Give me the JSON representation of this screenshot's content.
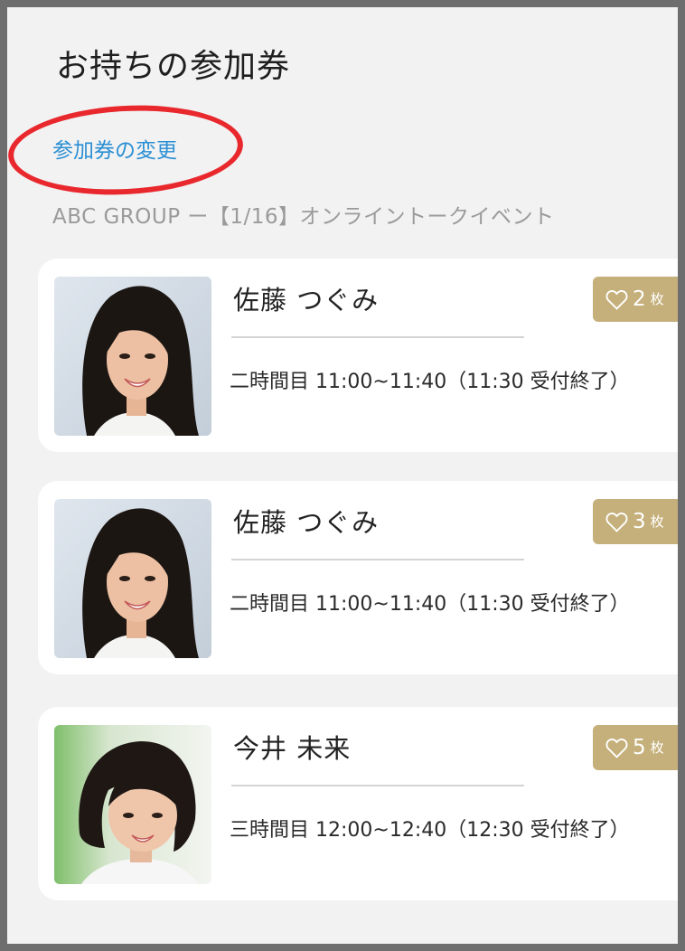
{
  "header": {
    "title": "お持ちの参加券",
    "change_link": "参加券の変更",
    "event_name": "ABC GROUP ー【1/16】オンライントークイベント"
  },
  "tickets": [
    {
      "member_name": "佐藤 つぐみ",
      "slot": "二時間目 11:00~11:40（11:30 受付終了）",
      "count": "2",
      "unit": "枚",
      "icon": "heart-outline-icon"
    },
    {
      "member_name": "佐藤 つぐみ",
      "slot": "二時間目 11:00~11:40（11:30 受付終了）",
      "count": "3",
      "unit": "枚",
      "icon": "heart-outline-icon"
    },
    {
      "member_name": "今井 未来",
      "slot": "三時間目 12:00~12:40（12:30 受付終了）",
      "count": "5",
      "unit": "枚",
      "icon": "heart-outline-icon"
    }
  ],
  "colors": {
    "background": "#f2f2f2",
    "link": "#2b8fd4",
    "highlight": "#e8282d",
    "badge": "#c5b07b",
    "muted_text": "#9a9a9a",
    "card": "#ffffff"
  }
}
